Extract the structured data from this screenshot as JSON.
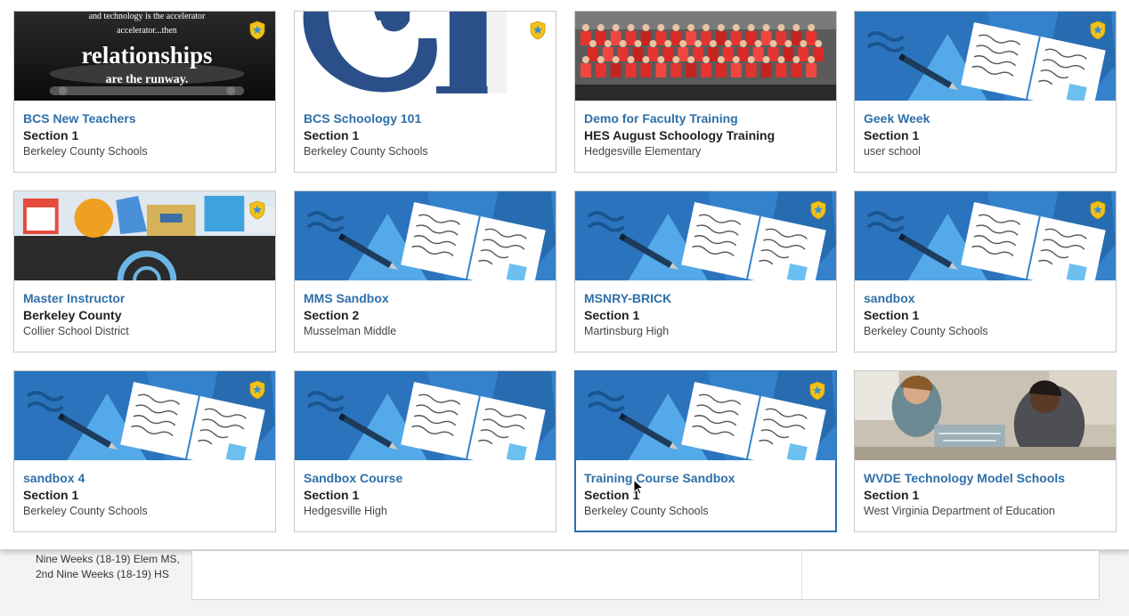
{
  "courses": [
    {
      "title": "BCS New Teachers",
      "section": "Section 1",
      "school": "Berkeley County Schools",
      "cover": "photo-relationships",
      "cover_text_top": "and technology is the accelerator...then",
      "cover_text_main": "relationships",
      "cover_text_bottom": "are the runway.",
      "featured": true
    },
    {
      "title": "BCS Schoology 101",
      "section": "Section 1",
      "school": "Berkeley County Schools",
      "cover": "logo-schoology",
      "featured": true
    },
    {
      "title": "Demo for Faculty Training",
      "section": "HES August Schoology Training",
      "school": "Hedgesville Elementary",
      "cover": "photo-group",
      "featured": false
    },
    {
      "title": "Geek Week",
      "section": "Section 1",
      "school": "user school",
      "cover": "default-book",
      "featured": true
    },
    {
      "title": "Master Instructor",
      "section": "Berkeley County",
      "school": "Collier School District",
      "cover": "icons-collage",
      "featured": true
    },
    {
      "title": "MMS Sandbox",
      "section": "Section 2",
      "school": "Musselman Middle",
      "cover": "default-book",
      "featured": false
    },
    {
      "title": "MSNRY-BRICK",
      "section": "Section 1",
      "school": "Martinsburg High",
      "cover": "default-book",
      "featured": true
    },
    {
      "title": "sandbox",
      "section": "Section 1",
      "school": "Berkeley County Schools",
      "cover": "default-book",
      "featured": true
    },
    {
      "title": "sandbox 4",
      "section": "Section 1",
      "school": "Berkeley County Schools",
      "cover": "default-book",
      "featured": true
    },
    {
      "title": "Sandbox Course",
      "section": "Section 1",
      "school": "Hedgesville High",
      "cover": "default-book",
      "featured": false
    },
    {
      "title": "Training Course Sandbox",
      "section": "Section 1",
      "school": "Berkeley County Schools",
      "cover": "default-book",
      "featured": true,
      "selected": true
    },
    {
      "title": "WVDE Technology Model Schools",
      "section": "Section 1",
      "school": "West Virginia Department of Education",
      "cover": "photo-students",
      "featured": false
    }
  ],
  "background": {
    "term_line1": "Nine Weeks (18-19) Elem MS,",
    "term_line2": "2nd Nine Weeks (18-19) HS"
  },
  "colors": {
    "link": "#2f6fa8",
    "cover_blue": "#2b74bd",
    "badge_gold": "#f2c21b",
    "selected_border": "#2b6cad"
  }
}
